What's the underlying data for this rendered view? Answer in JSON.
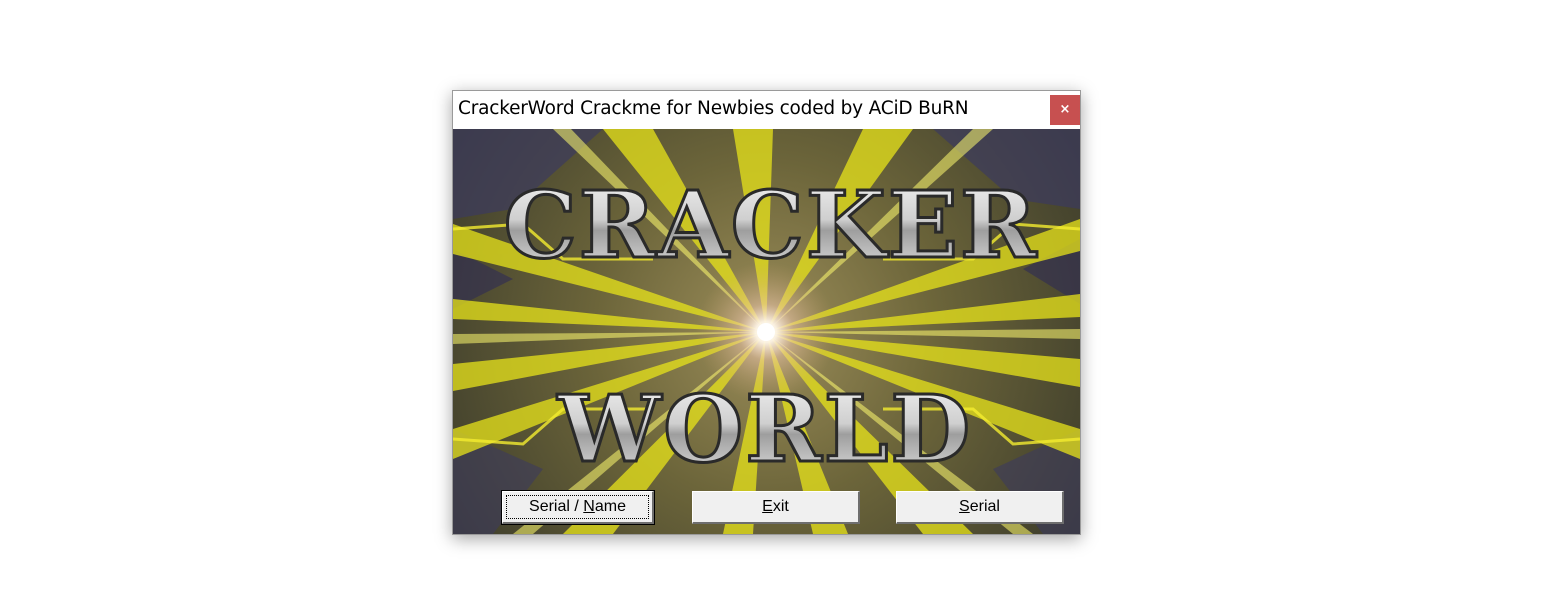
{
  "window": {
    "title": "CrackerWord Crackme for Newbies coded by ACiD BuRN",
    "close_glyph": "×",
    "close_color": "#c75050"
  },
  "logo": {
    "line1": "CRACKER",
    "line2": "WORLD"
  },
  "buttons": {
    "serial_name": {
      "pre": "Serial / ",
      "mnemonic": "N",
      "post": "ame"
    },
    "exit": {
      "pre": "",
      "mnemonic": "E",
      "post": "xit"
    },
    "serial": {
      "pre": "",
      "mnemonic": "S",
      "post": "erial"
    }
  },
  "colors": {
    "beam_yellow": "#e8e41a",
    "beam_dark": "#4a4419",
    "flare_center": "#ffffff",
    "logo_silver": "#d8d8d8",
    "button_face": "#f0f0f0"
  }
}
